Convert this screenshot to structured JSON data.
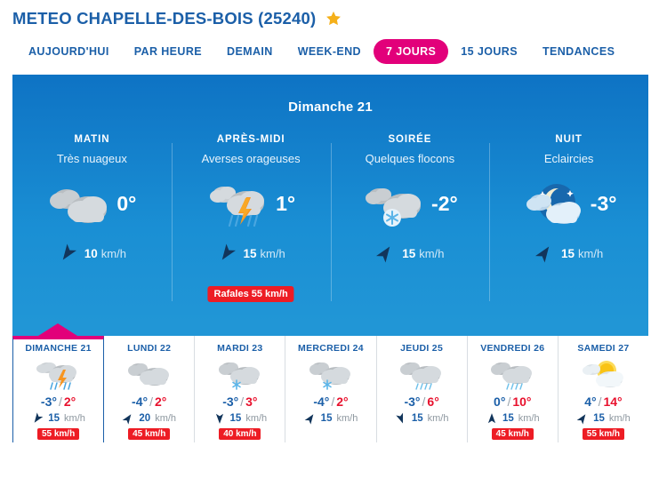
{
  "header": {
    "title": "METEO CHAPELLE-DES-BOIS (25240)",
    "favorite_icon": "star-icon",
    "title_color": "#1b5fa8",
    "star_color": "#f5b01a"
  },
  "tabs": {
    "items": [
      {
        "label": "AUJOURD'HUI",
        "active": false
      },
      {
        "label": "PAR HEURE",
        "active": false
      },
      {
        "label": "DEMAIN",
        "active": false
      },
      {
        "label": "WEEK-END",
        "active": false
      },
      {
        "label": "7 JOURS",
        "active": true
      },
      {
        "label": "15 JOURS",
        "active": false
      },
      {
        "label": "TENDANCES",
        "active": false
      }
    ],
    "active_bg": "#e2007a",
    "inactive_color": "#1b5fa8"
  },
  "panel": {
    "date_title": "Dimanche 21",
    "bg_top": "#0e73c4",
    "bg_bottom": "#2196d6",
    "quarters": [
      {
        "label": "MATIN",
        "description": "Très nuageux",
        "icon": "cloudy-icon",
        "temperature": "0°",
        "wind_speed": "10",
        "wind_unit": "km/h",
        "wind_direction_deg": 215,
        "gust": null
      },
      {
        "label": "APRÈS-MIDI",
        "description": "Averses orageuses",
        "icon": "thunderstorm-rain-icon",
        "temperature": "1°",
        "wind_speed": "15",
        "wind_unit": "km/h",
        "wind_direction_deg": 215,
        "gust": "Rafales 55 km/h"
      },
      {
        "label": "SOIRÉE",
        "description": "Quelques flocons",
        "icon": "cloudy-snow-icon",
        "temperature": "-2°",
        "wind_speed": "15",
        "wind_unit": "km/h",
        "wind_direction_deg": 35,
        "gust": null
      },
      {
        "label": "NUIT",
        "description": "Eclaircies",
        "icon": "night-partly-cloudy-icon",
        "temperature": "-3°",
        "wind_speed": "15",
        "wind_unit": "km/h",
        "wind_direction_deg": 35,
        "gust": null
      }
    ],
    "gust_badge_color": "#ed1c24"
  },
  "days": {
    "selected_index": 0,
    "selected_marker_color": "#e2007a",
    "items": [
      {
        "name": "DIMANCHE 21",
        "icon": "thunderstorm-rain-icon",
        "tmin": "-3°",
        "sep": "/",
        "tmax": "2°",
        "wind_speed": "15",
        "wind_unit": "km/h",
        "wind_direction_deg": 215,
        "gust": "55 km/h"
      },
      {
        "name": "LUNDI 22",
        "icon": "cloudy-icon",
        "tmin": "-4°",
        "sep": "/",
        "tmax": "2°",
        "wind_speed": "20",
        "wind_unit": "km/h",
        "wind_direction_deg": 35,
        "gust": "45 km/h"
      },
      {
        "name": "MARDI 23",
        "icon": "cloudy-snow-icon",
        "tmin": "-3°",
        "sep": "/",
        "tmax": "3°",
        "wind_speed": "15",
        "wind_unit": "km/h",
        "wind_direction_deg": 180,
        "gust": "40 km/h"
      },
      {
        "name": "MERCREDI 24",
        "icon": "cloudy-snow-icon",
        "tmin": "-4°",
        "sep": "/",
        "tmax": "2°",
        "wind_speed": "15",
        "wind_unit": "km/h",
        "wind_direction_deg": 35,
        "gust": null
      },
      {
        "name": "JEUDI 25",
        "icon": "cloudy-rain-icon",
        "tmin": "-3°",
        "sep": "/",
        "tmax": "6°",
        "wind_speed": "15",
        "wind_unit": "km/h",
        "wind_direction_deg": 160,
        "gust": null
      },
      {
        "name": "VENDREDI 26",
        "icon": "cloudy-rain-icon",
        "tmin": "0°",
        "sep": "/",
        "tmax": "10°",
        "wind_speed": "15",
        "wind_unit": "km/h",
        "wind_direction_deg": 0,
        "gust": "45 km/h"
      },
      {
        "name": "SAMEDI 27",
        "icon": "sun-cloud-icon",
        "tmin": "4°",
        "sep": "/",
        "tmax": "14°",
        "wind_speed": "15",
        "wind_unit": "km/h",
        "wind_direction_deg": 35,
        "gust": "55 km/h"
      }
    ]
  }
}
